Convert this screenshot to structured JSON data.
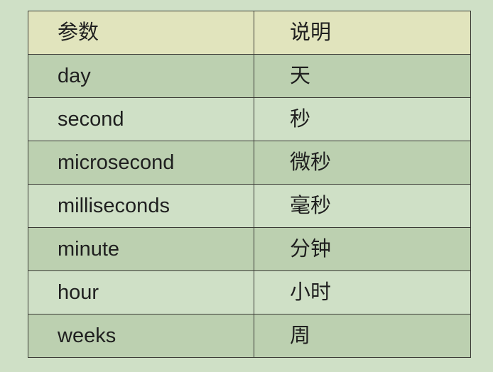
{
  "table": {
    "headers": [
      "参数",
      "说明"
    ],
    "rows": [
      [
        "day",
        "天"
      ],
      [
        "second",
        "秒"
      ],
      [
        "microsecond",
        "微秒"
      ],
      [
        "milliseconds",
        "毫秒"
      ],
      [
        "minute",
        "分钟"
      ],
      [
        "hour",
        "小时"
      ],
      [
        "weeks",
        "周"
      ]
    ]
  },
  "colors": {
    "page_background": "#cfe0c6",
    "header_background": "#e1e4bd",
    "striped_row_background": "#bcd0b0",
    "plain_row_background": "#cfe0c6",
    "border": "#3a3a35",
    "text": "#1f1f1f"
  }
}
